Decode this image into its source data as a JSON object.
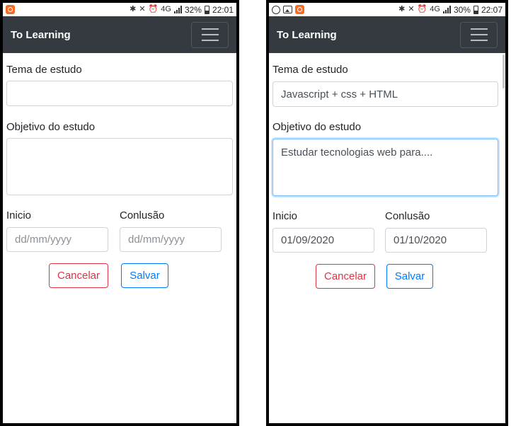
{
  "screens": [
    {
      "status_bar": {
        "battery": "32%",
        "time": "22:01",
        "network": "4G"
      },
      "app_title": "To Learning",
      "form": {
        "topic_label": "Tema de estudo",
        "topic_value": "",
        "goal_label": "Objetivo do estudo",
        "goal_value": "",
        "start_label": "Inicio",
        "start_value": "dd/mm/yyyy",
        "end_label": "Conlusão",
        "end_value": "dd/mm/yyyy"
      },
      "buttons": {
        "cancel": "Cancelar",
        "save": "Salvar"
      }
    },
    {
      "status_bar": {
        "battery": "30%",
        "time": "22:07",
        "network": "4G"
      },
      "app_title": "To Learning",
      "form": {
        "topic_label": "Tema de estudo",
        "topic_value": "Javascript + css + HTML",
        "goal_label": "Objetivo do estudo",
        "goal_value": "Estudar tecnologias web para....",
        "start_label": "Inicio",
        "start_value": "01/09/2020",
        "end_label": "Conlusão",
        "end_value": "01/10/2020"
      },
      "buttons": {
        "cancel": "Cancelar",
        "save": "Salvar"
      }
    }
  ],
  "icons": {
    "status_left_1": [
      "app-notification-icon"
    ],
    "status_left_2": [
      "whatsapp-icon",
      "image-icon",
      "app-notification-icon"
    ],
    "status_right": [
      "bluetooth-icon",
      "mute-icon",
      "alarm-icon",
      "signal-icon",
      "battery-icon"
    ],
    "menu": "hamburger-menu-icon"
  },
  "colors": {
    "navbar": "#343a40",
    "cancel": "#dc3545",
    "save": "#007bff",
    "notification": "#f36c21"
  }
}
